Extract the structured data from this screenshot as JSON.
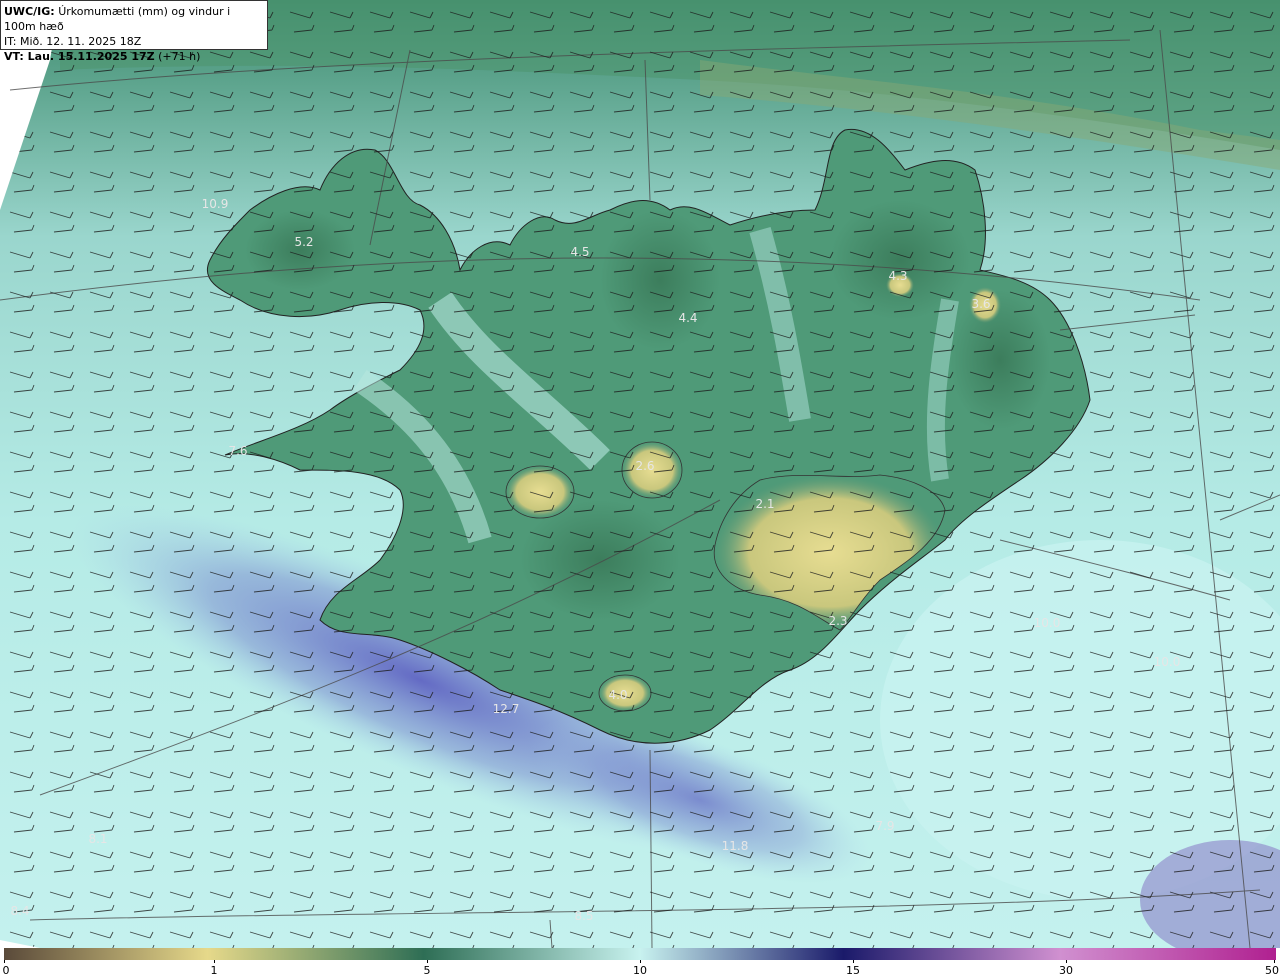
{
  "header": {
    "model": "UWC/IG:",
    "title": "Úrkomumætti (mm) og vindur i 100m hæð",
    "init_time": "IT: Mið. 12. 11. 2025 18Z",
    "valid_prefix": "VT: Lau. 15.11.2025 17Z",
    "valid_suffix": "(+71 h)"
  },
  "map_labels": [
    {
      "text": "10.9",
      "name": "value-label-nw-sea"
    },
    {
      "text": "5.2",
      "name": "value-label-westfjords"
    },
    {
      "text": "4.5",
      "name": "value-label-north-west"
    },
    {
      "text": "4.3",
      "name": "value-label-northeast"
    },
    {
      "text": "3.6",
      "name": "value-label-east"
    },
    {
      "text": "4.4",
      "name": "value-label-north"
    },
    {
      "text": "7.6",
      "name": "value-label-snaefellsnes"
    },
    {
      "text": "2.6",
      "name": "value-label-langjokull"
    },
    {
      "text": "2.1",
      "name": "value-label-vatnajokull"
    },
    {
      "text": "2.3",
      "name": "value-label-oraefajokull"
    },
    {
      "text": "10.0",
      "name": "value-label-east-sea-1"
    },
    {
      "text": "10.0",
      "name": "value-label-east-sea-2"
    },
    {
      "text": "4.0",
      "name": "value-label-south"
    },
    {
      "text": "12.7",
      "name": "value-label-reykjanes-sea"
    },
    {
      "text": "11.8",
      "name": "value-label-south-sea"
    },
    {
      "text": "8.1",
      "name": "value-label-sw-sea"
    },
    {
      "text": "7.9",
      "name": "value-label-se-sea"
    },
    {
      "text": "8.4",
      "name": "value-label-bottom-left"
    },
    {
      "text": "8.5",
      "name": "value-label-bottom-center"
    }
  ],
  "colorbar": {
    "ticks": [
      "0",
      "1",
      "5",
      "10",
      "15",
      "30",
      "50"
    ],
    "colors": [
      "#5a4a3a",
      "#e6d98a",
      "#2e6e55",
      "#c8f2ef",
      "#2a2a9a",
      "#c060c0",
      "#b02090"
    ]
  }
}
